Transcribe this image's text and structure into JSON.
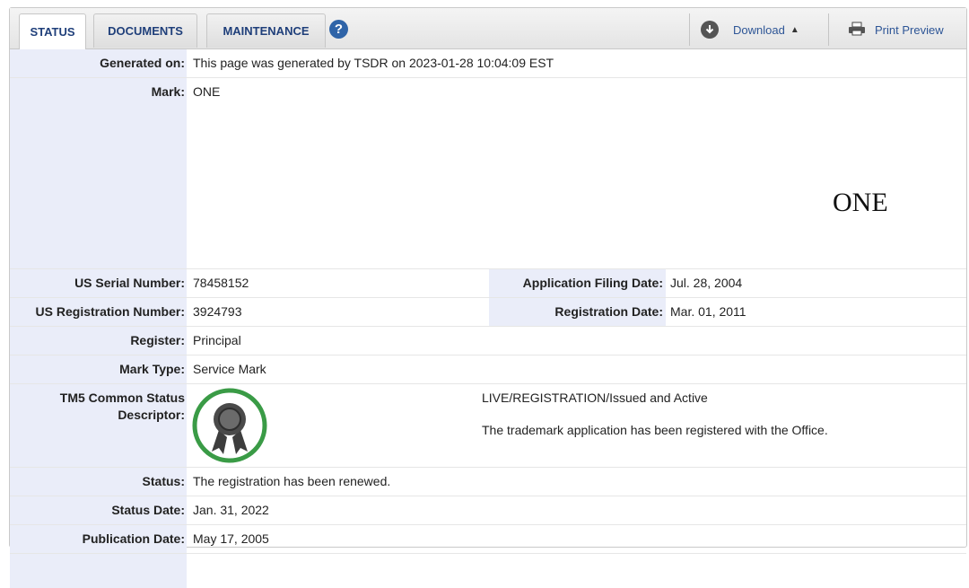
{
  "tabs": {
    "status": "STATUS",
    "documents": "DOCUMENTS",
    "maintenance": "MAINTENANCE",
    "help_glyph": "?"
  },
  "toolbar": {
    "download_label": "Download",
    "download_caret": "▲",
    "print_preview_label": "Print Preview"
  },
  "fields": {
    "generated_on": {
      "label": "Generated on:",
      "value": "This page was generated by TSDR on 2023-01-28 10:04:09 EST"
    },
    "mark": {
      "label": "Mark:",
      "value": "ONE",
      "image_text": "ONE"
    },
    "serial": {
      "label": "US Serial Number:",
      "value": "78458152"
    },
    "filing_date": {
      "label": "Application Filing Date:",
      "value": "Jul. 28, 2004"
    },
    "registration_number": {
      "label": "US Registration Number:",
      "value": "3924793"
    },
    "registration_date": {
      "label": "Registration Date:",
      "value": "Mar. 01, 2011"
    },
    "register": {
      "label": "Register:",
      "value": "Principal"
    },
    "mark_type": {
      "label": "Mark Type:",
      "value": "Service Mark"
    },
    "tm5": {
      "label_line1": "TM5 Common Status",
      "label_line2": "Descriptor:",
      "status_code": "LIVE/REGISTRATION/Issued and Active",
      "description": "The trademark application has been registered with the Office."
    },
    "status": {
      "label": "Status:",
      "value": "The registration has been renewed."
    },
    "status_date": {
      "label": "Status Date:",
      "value": "Jan. 31, 2022"
    },
    "publication_date": {
      "label": "Publication Date:",
      "value": "May 17, 2005"
    }
  },
  "colors": {
    "label_bg": "#eaedf9",
    "link": "#2d5596",
    "badge_ring": "#3a9b46"
  },
  "icons": {
    "help": "help-icon",
    "download": "download-icon",
    "print": "printer-icon",
    "badge": "registered-ribbon-icon"
  }
}
